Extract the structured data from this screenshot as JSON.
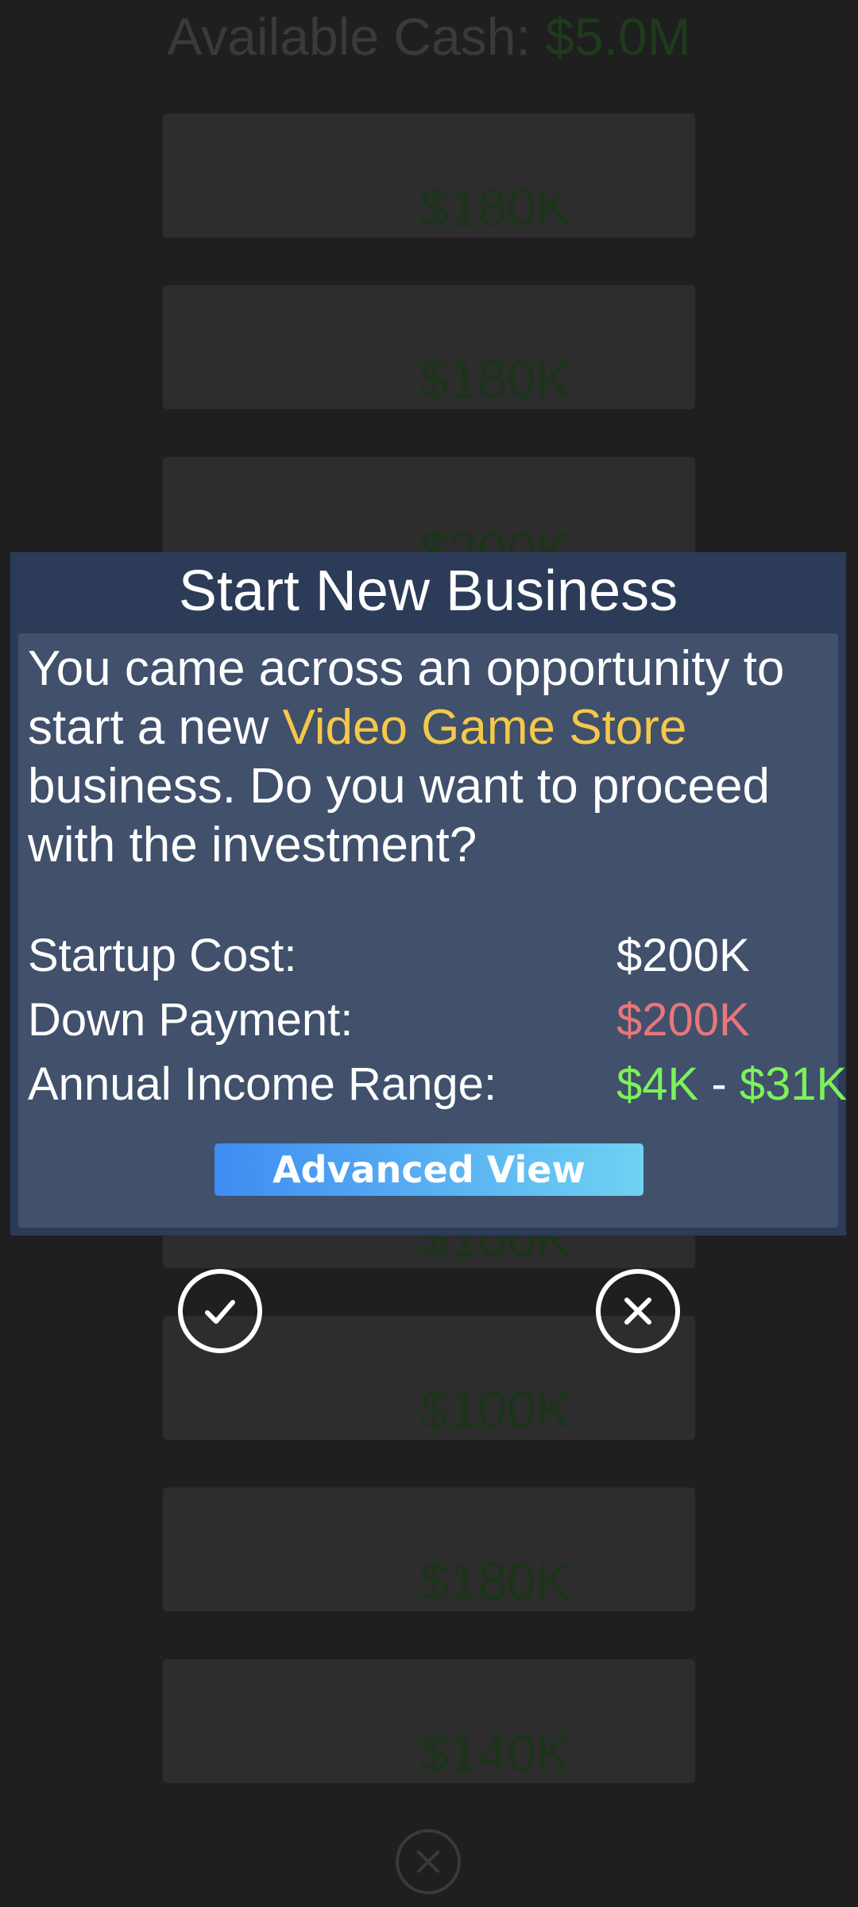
{
  "background": {
    "cash_label": "Available Cash: ",
    "cash_value": "$5.0M",
    "cards": [
      {
        "price": "$180K"
      },
      {
        "price": "$180K"
      },
      {
        "price": "$200K"
      },
      {
        "price": "$100K"
      },
      {
        "price": "$100K"
      },
      {
        "price": "$180K"
      },
      {
        "price": "$140K"
      }
    ]
  },
  "modal": {
    "title": "Start New Business",
    "desc_part1": "You came across an opportunity to start a new ",
    "business_name": "Video Game Store",
    "desc_part2": " business. Do you want to proceed with the investment?",
    "startup_cost_label": "Startup Cost:",
    "startup_cost_value": "$200K",
    "down_payment_label": "Down Payment:",
    "down_payment_value": "$200K",
    "income_label": "Annual Income Range:",
    "income_min": "$4K",
    "income_separator": " - ",
    "income_max": "$31K",
    "advanced_view_label": "Advanced View"
  },
  "icons": {
    "confirm": "check-icon",
    "cancel": "close-icon",
    "background_close": "close-icon"
  },
  "colors": {
    "modal_header": "#2c3b58",
    "modal_body": "#41506b",
    "business_highlight": "#f4c84a",
    "down_payment": "#e8767a",
    "income": "#7cf25a"
  }
}
